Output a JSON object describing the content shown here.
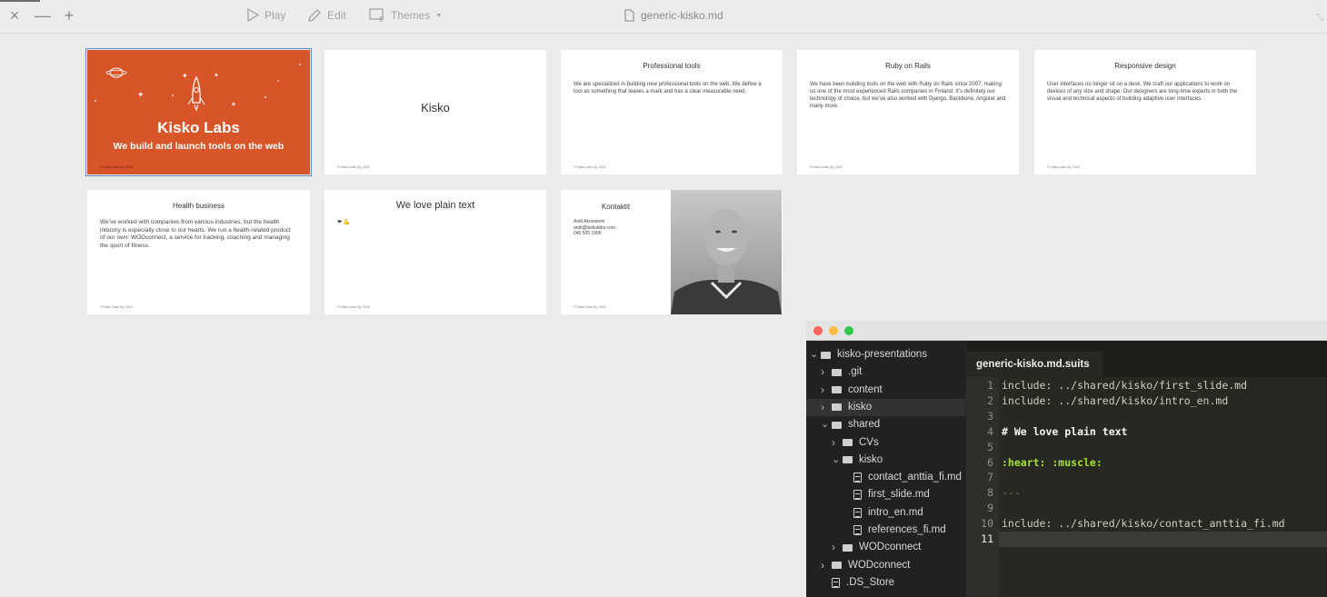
{
  "toolbar": {
    "close": "×",
    "minimize": "—",
    "add": "+",
    "play": "Play",
    "edit": "Edit",
    "themes": "Themes",
    "filename": "generic-kisko.md"
  },
  "slides": [
    {
      "title": "Kisko Labs",
      "subtitle": "We build and launch tools on the web",
      "footer": "© Kisko Labs Oy, 2015"
    },
    {
      "title": "Kisko",
      "footer": "© Kisko Labs Oy, 2015"
    },
    {
      "title": "Professional tools",
      "body": "We are specialized in building new professional tools on the web. We define a tool as something that leaves a mark and has a clear measurable need.",
      "footer": "© Kisko Labs Oy, 2015"
    },
    {
      "title": "Ruby on Rails",
      "body": "We have been building tools on the web with Ruby on Rails since 2007, making us one of the most experienced Rails companies in Finland. It’s definitely our technology of choice, but we’ve also worked with Django, Backbone, Angular and many more.",
      "footer": "© Kisko Labs Oy, 2015"
    },
    {
      "title": "Responsive design",
      "body": "User interfaces no longer sit on a desk. We craft our applications to work on devices of any size and shape. Our designers are long-time experts in both the visual and technical aspects of building adaptive user interfaces.",
      "footer": "© Kisko Labs Oy, 2015"
    },
    {
      "title": "Health business",
      "body": "We’ve worked with companies from various industries, but the health industry is especially close to our hearts. We run a health-related product of our own: WODconnect, a service for tracking, coaching and managing the sport of fitness.",
      "footer": "© Kisko Labs Oy, 2015"
    },
    {
      "title": "We love plain text",
      "emoji": "❤ 💪",
      "footer": "© Kisko Labs Oy, 2015"
    },
    {
      "title": "Kontaktit",
      "name": "Antti Akonniemi",
      "email": "antti@kiskolabs.com",
      "phone": "040 505 1999",
      "footer": "© Kisko Labs Oy, 2015"
    }
  ],
  "tree": [
    {
      "label": "kisko-presentations",
      "indent": 0,
      "kind": "folder",
      "open": true
    },
    {
      "label": ".git",
      "indent": 1,
      "kind": "folder",
      "open": false
    },
    {
      "label": "content",
      "indent": 1,
      "kind": "folder",
      "open": false
    },
    {
      "label": "kisko",
      "indent": 1,
      "kind": "folder",
      "open": false,
      "highlight": true
    },
    {
      "label": "shared",
      "indent": 1,
      "kind": "folder",
      "open": true
    },
    {
      "label": "CVs",
      "indent": 2,
      "kind": "folder",
      "open": false
    },
    {
      "label": "kisko",
      "indent": 2,
      "kind": "folder",
      "open": true
    },
    {
      "label": "contact_anttia_fi.md",
      "indent": 3,
      "kind": "file"
    },
    {
      "label": "first_slide.md",
      "indent": 3,
      "kind": "file"
    },
    {
      "label": "intro_en.md",
      "indent": 3,
      "kind": "file"
    },
    {
      "label": "references_fi.md",
      "indent": 3,
      "kind": "file"
    },
    {
      "label": "WODconnect",
      "indent": 2,
      "kind": "folder",
      "open": false
    },
    {
      "label": "WODconnect",
      "indent": 1,
      "kind": "folder",
      "open": false
    },
    {
      "label": ".DS_Store",
      "indent": 1,
      "kind": "file"
    }
  ],
  "editor": {
    "tab": "generic-kisko.md.suits",
    "tab_close": "×",
    "current_line": 11,
    "lines": [
      {
        "n": "1",
        "text": "include: ../shared/kisko/first_slide.md",
        "style": ""
      },
      {
        "n": "2",
        "text": "include: ../shared/kisko/intro_en.md",
        "style": ""
      },
      {
        "n": "3",
        "text": "",
        "style": ""
      },
      {
        "n": "4",
        "text": "# We love plain text",
        "style": "h"
      },
      {
        "n": "5",
        "text": "",
        "style": ""
      },
      {
        "n": "6",
        "text": ":heart: :muscle:",
        "style": "g"
      },
      {
        "n": "7",
        "text": "",
        "style": ""
      },
      {
        "n": "8",
        "text": "---",
        "style": "dim"
      },
      {
        "n": "9",
        "text": "",
        "style": ""
      },
      {
        "n": "10",
        "text": "include: ../shared/kisko/contact_anttia_fi.md",
        "style": ""
      },
      {
        "n": "11",
        "text": "",
        "style": ""
      }
    ]
  },
  "colors": {
    "accent_orange": "#d8552a",
    "selection_blue": "#5b8fd6",
    "editor_bg": "#272822"
  }
}
